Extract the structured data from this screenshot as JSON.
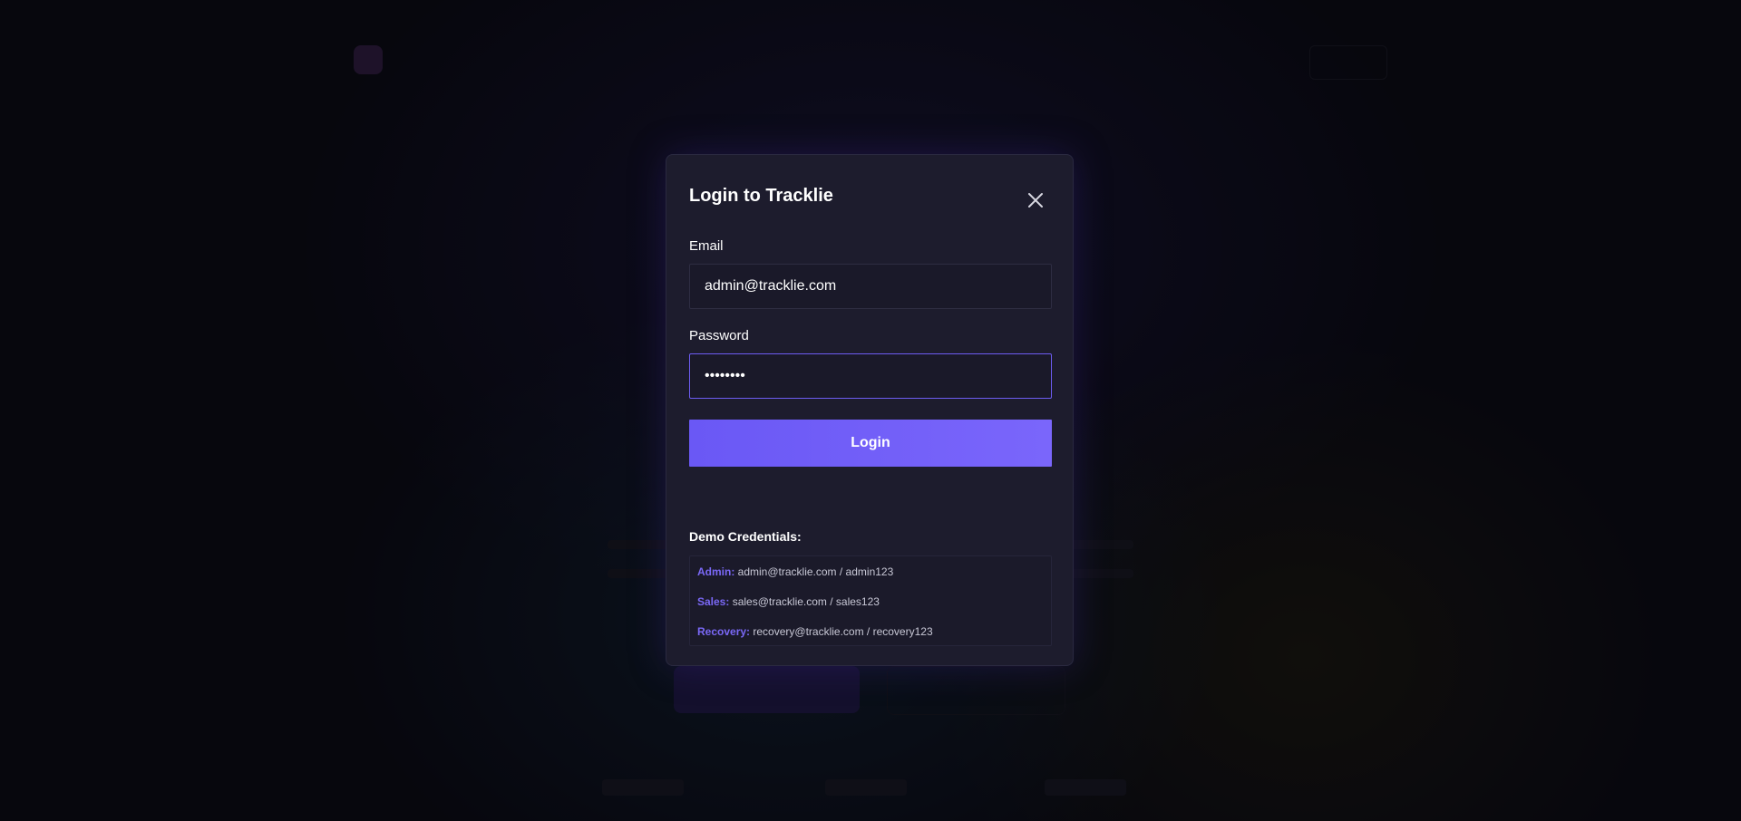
{
  "modal": {
    "title": "Login to Tracklie",
    "close_icon": "close-icon",
    "email": {
      "label": "Email",
      "value": "admin@tracklie.com"
    },
    "password": {
      "label": "Password",
      "value": "••••••••"
    },
    "login_button": "Login",
    "demo": {
      "title": "Demo Credentials:",
      "items": [
        {
          "role": "Admin:",
          "creds": "admin@tracklie.com / admin123"
        },
        {
          "role": "Sales:",
          "creds": "sales@tracklie.com / sales123"
        },
        {
          "role": "Recovery:",
          "creds": "recovery@tracklie.com / recovery123"
        }
      ]
    }
  },
  "colors": {
    "accent": "#6d5cf2",
    "modal_bg": "#1d1c2d",
    "role_label": "#7a68f6"
  }
}
